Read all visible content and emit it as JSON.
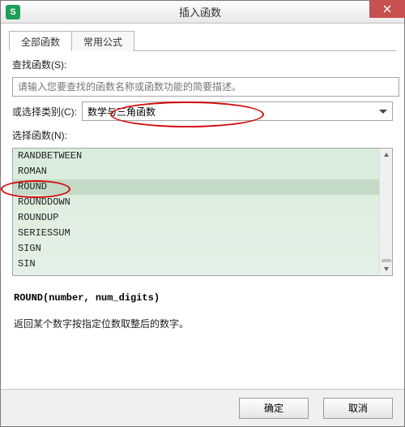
{
  "window": {
    "title": "插入函数",
    "app_icon_letter": "S"
  },
  "tabs": {
    "all": "全部函数",
    "common": "常用公式"
  },
  "search": {
    "label": "查找函数(S):",
    "placeholder": "请输入您要查找的函数名称或函数功能的简要描述。"
  },
  "category": {
    "label": "或选择类别(C):",
    "value": "数学与三角函数"
  },
  "functionList": {
    "label": "选择函数(N):",
    "items": [
      "RANDBETWEEN",
      "ROMAN",
      "ROUND",
      "ROUNDDOWN",
      "ROUNDUP",
      "SERIESSUM",
      "SIGN",
      "SIN"
    ],
    "selected": "ROUND"
  },
  "preview": {
    "syntax": "ROUND(number, num_digits)",
    "description": "返回某个数字按指定位数取整后的数字。"
  },
  "buttons": {
    "ok": "确定",
    "cancel": "取消"
  }
}
